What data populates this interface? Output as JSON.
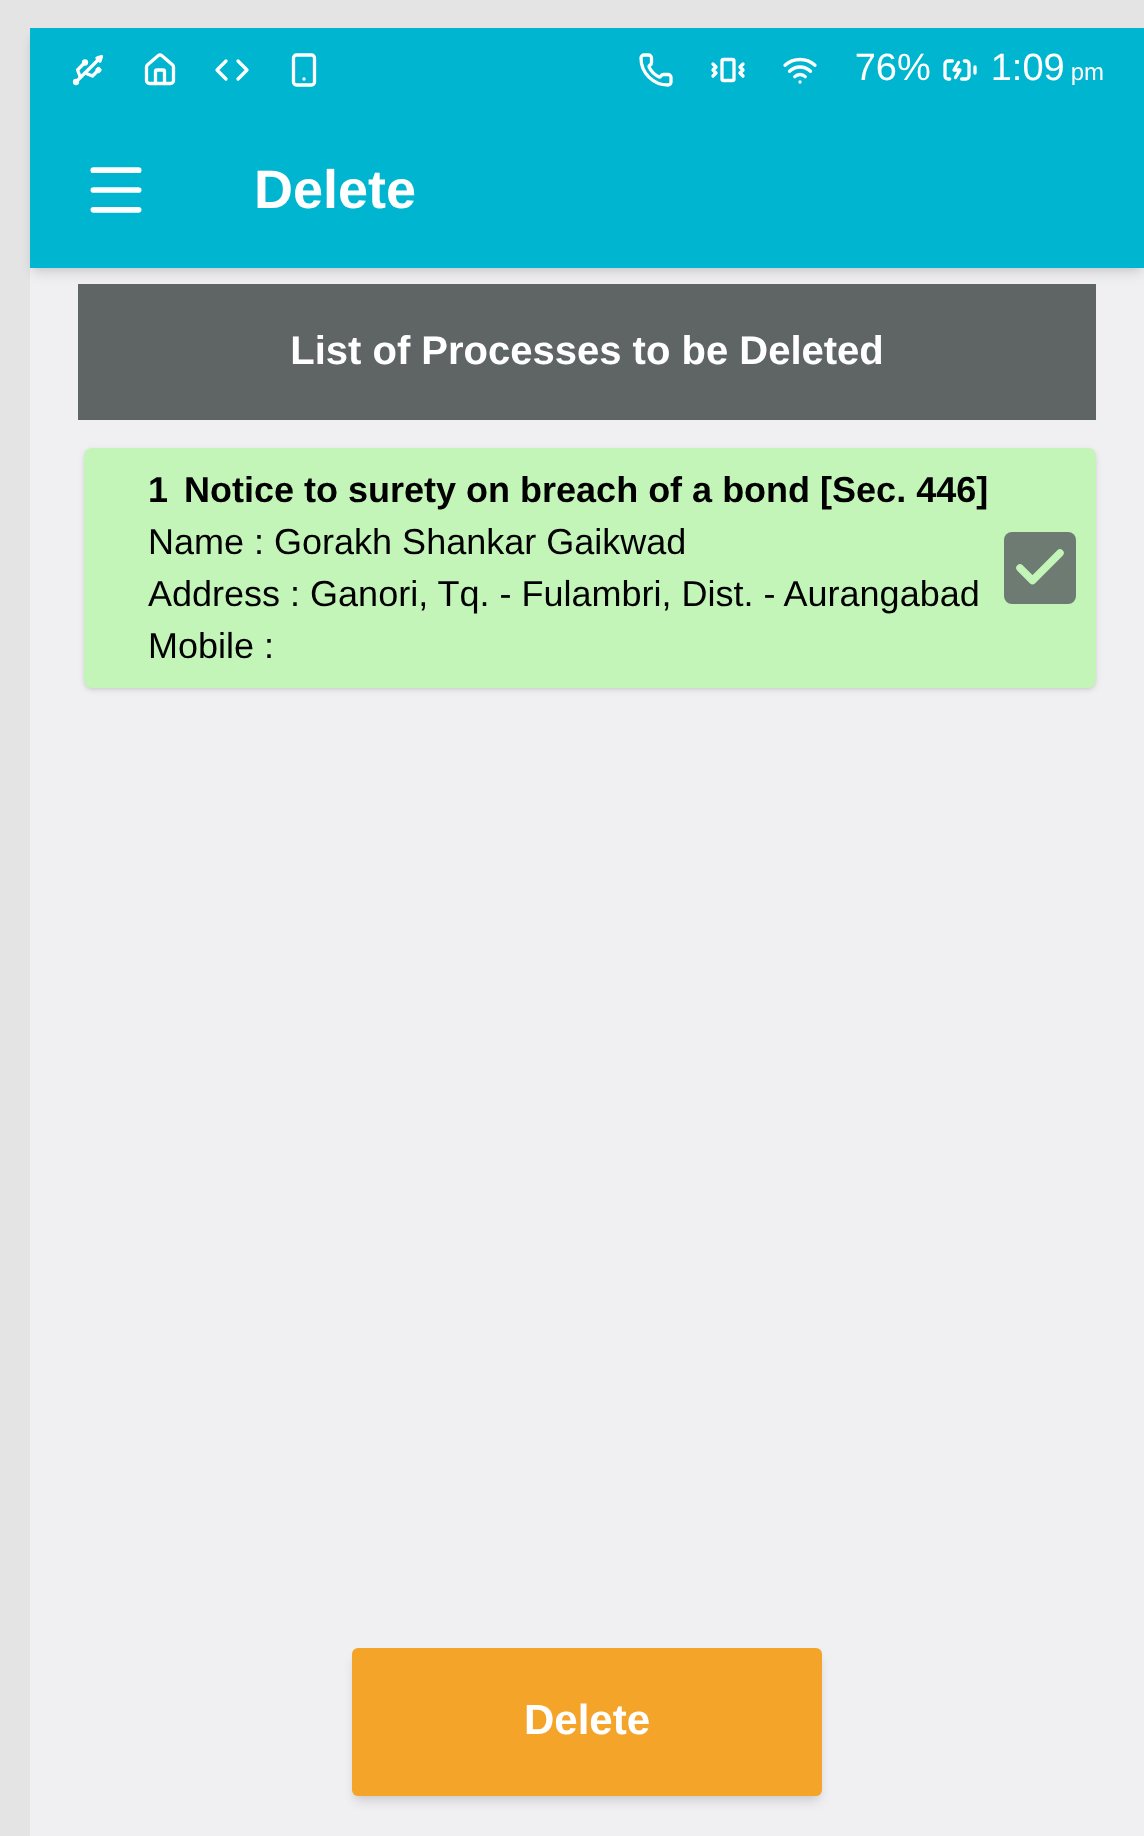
{
  "status_bar": {
    "battery_percent": "76%",
    "time": "1:09",
    "time_suffix": "pm"
  },
  "app_bar": {
    "title": "Delete"
  },
  "list_header": "List of Processes to be Deleted",
  "processes": [
    {
      "number": "1",
      "title": "Notice to surety on breach of a bond [Sec. 446]",
      "name_label": "Name :",
      "name": "Gorakh Shankar Gaikwad",
      "address_label": "Address :",
      "address": "Ganori, Tq. - Fulambri, Dist. - Aurangabad",
      "mobile_label": "Mobile :",
      "checked": true
    }
  ],
  "delete_button": "Delete"
}
